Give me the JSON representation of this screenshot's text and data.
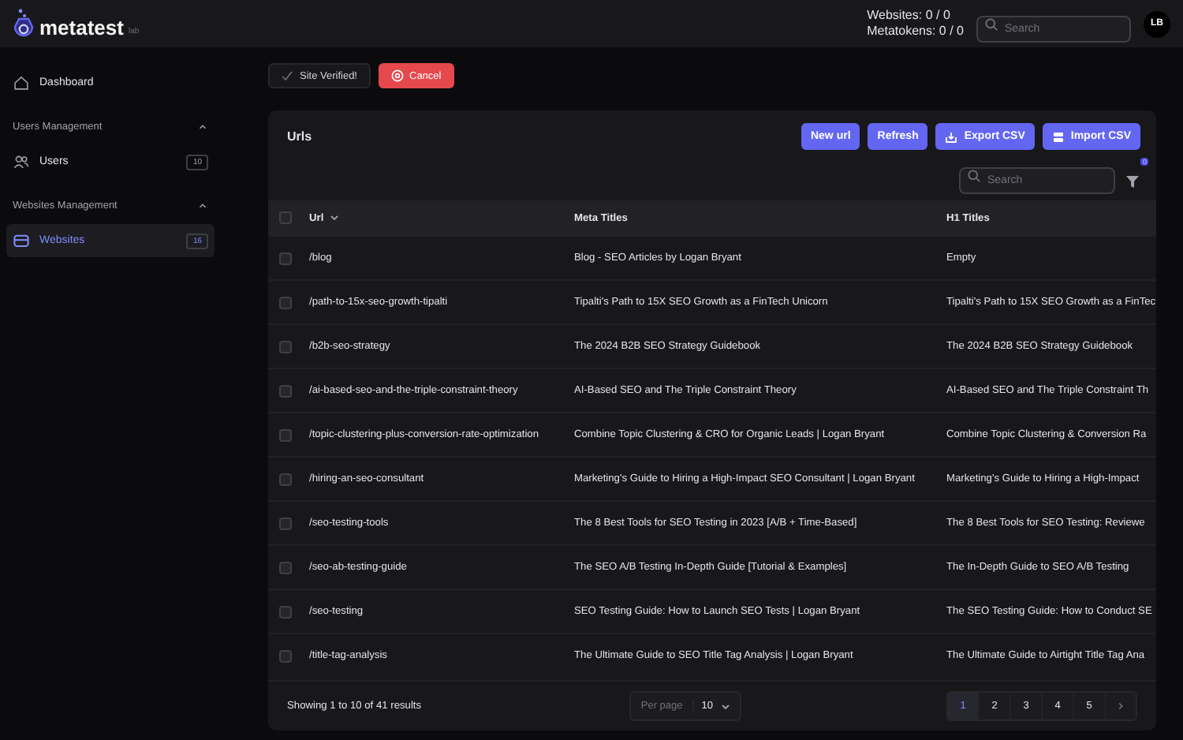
{
  "header": {
    "logo": "metatest",
    "logo_sub": "lab",
    "stats": [
      "Websites: 0 / 0",
      "Metatokens: 0 / 0"
    ],
    "search": {
      "placeholder": "Search"
    },
    "avatar": "LB"
  },
  "sidebar": {
    "items": [
      {
        "kind": "link",
        "label": "Dashboard",
        "selected": false
      },
      {
        "kind": "section",
        "label": "Users Management",
        "expanded": true,
        "children": [
          {
            "label": "Users",
            "badge": "10",
            "selected": false
          }
        ]
      },
      {
        "kind": "section",
        "label": "Websites Management",
        "expanded": true,
        "children": [
          {
            "label": "Websites",
            "badge": "16",
            "selected": true
          }
        ]
      }
    ]
  },
  "actions": [
    {
      "kind": "verified",
      "label": "Site Verified!"
    },
    {
      "kind": "danger",
      "label": "Cancel"
    }
  ],
  "card": {
    "title": "Urls",
    "buttons": [
      {
        "label": "New url"
      },
      {
        "label": "Refresh"
      },
      {
        "label": "Export CSV"
      },
      {
        "label": "Import CSV"
      }
    ],
    "search": {
      "placeholder": "Search"
    },
    "filter_count": "0",
    "table": {
      "select_all": {
        "checked": false
      },
      "columns": [
        {
          "label": "Url"
        },
        {
          "label": "Meta Titles"
        },
        {
          "label": "H1 Titles"
        }
      ],
      "rows": [
        {
          "checked": false,
          "cells": [
            "/blog",
            "Blog - SEO Articles by Logan Bryant",
            "Empty"
          ]
        },
        {
          "checked": false,
          "cells": [
            "/path-to-15x-seo-growth-tipalti",
            "Tipalti's Path to 15X SEO Growth as a FinTech Unicorn",
            "Tipalti's Path to 15X SEO Growth as a FinTec"
          ]
        },
        {
          "checked": false,
          "cells": [
            "/b2b-seo-strategy",
            "The 2024 B2B SEO Strategy Guidebook",
            "The 2024 B2B SEO Strategy Guidebook"
          ]
        },
        {
          "checked": false,
          "cells": [
            "/ai-based-seo-and-the-triple-constraint-theory",
            "AI-Based SEO and The Triple Constraint Theory",
            "AI-Based SEO and The Triple Constraint Th"
          ]
        },
        {
          "checked": false,
          "cells": [
            "/topic-clustering-plus-conversion-rate-optimization",
            "Combine Topic Clustering & CRO for Organic Leads | Logan Bryant",
            "Combine Topic Clustering & Conversion Ra"
          ]
        },
        {
          "checked": false,
          "cells": [
            "/hiring-an-seo-consultant",
            "Marketing's Guide to Hiring a High-Impact SEO Consultant | Logan Bryant",
            "Marketing's Guide to Hiring a High-Impact"
          ]
        },
        {
          "checked": false,
          "cells": [
            "/seo-testing-tools",
            "The 8 Best Tools for SEO Testing in 2023 [A/B + Time-Based]",
            "The 8 Best Tools for SEO Testing: Reviewe"
          ]
        },
        {
          "checked": false,
          "cells": [
            "/seo-ab-testing-guide",
            "The SEO A/B Testing In-Depth Guide [Tutorial & Examples]",
            "The In-Depth Guide to SEO A/B Testing"
          ]
        },
        {
          "checked": false,
          "cells": [
            "/seo-testing",
            "SEO Testing Guide: How to Launch SEO Tests | Logan Bryant",
            "The SEO Testing Guide: How to Conduct SE"
          ]
        },
        {
          "checked": false,
          "cells": [
            "/title-tag-analysis",
            "The Ultimate Guide to SEO Title Tag Analysis | Logan Bryant",
            "The Ultimate Guide to Airtight Title Tag Ana"
          ]
        }
      ]
    },
    "footer": {
      "summary": "Showing 1 to 10 of 41 results",
      "per_page_label": "Per page",
      "per_page_value": "10",
      "pages": [
        {
          "label": "1",
          "selected": true
        },
        {
          "label": "2",
          "selected": false
        },
        {
          "label": "3",
          "selected": false
        },
        {
          "label": "4",
          "selected": false
        },
        {
          "label": "5",
          "selected": false
        }
      ]
    }
  }
}
